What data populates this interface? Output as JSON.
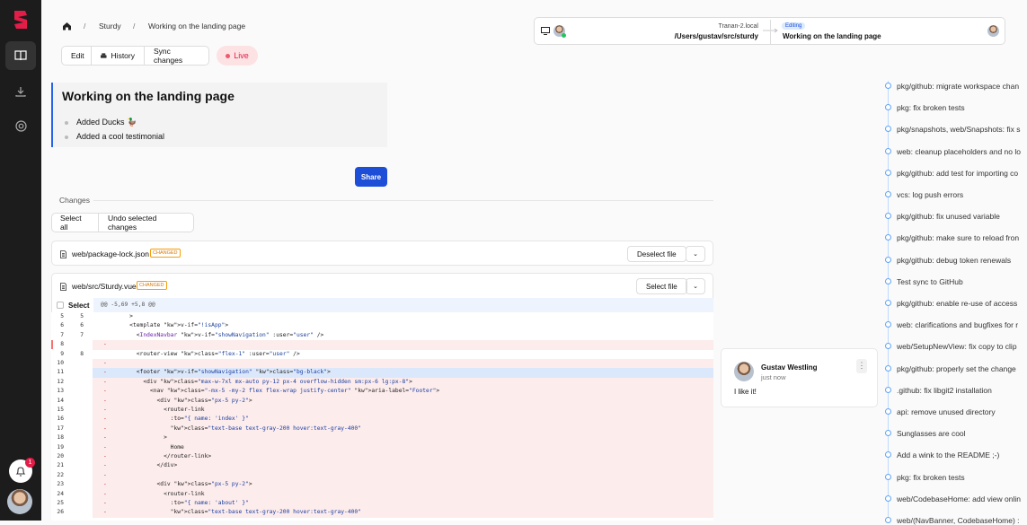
{
  "breadcrumb": {
    "home_icon": "home-icon",
    "repo": "Sturdy",
    "workspace": "Working on the landing page"
  },
  "toolbar": {
    "edit": "Edit",
    "history": "History",
    "sync": "Sync changes",
    "live": "Live"
  },
  "workspace": {
    "title": "Working on the landing page",
    "items": [
      "Added Ducks 🦆",
      "Added a cool testimonial"
    ],
    "share": "Share"
  },
  "changes": {
    "label": "Changes",
    "select_all": "Select all",
    "undo": "Undo selected changes"
  },
  "files": [
    {
      "name": "web/package-lock.json",
      "tag": "CHANGED",
      "button": "Deselect file"
    },
    {
      "name": "web/src/Sturdy.vue",
      "tag": "CHANGED",
      "button": "Select file",
      "select": "Select",
      "hunk": "@@ -5,69 +5,8 @@"
    }
  ],
  "diff_rows": [
    {
      "a": "5",
      "b": "5",
      "s": "",
      "c": "    >",
      "t": "n"
    },
    {
      "a": "6",
      "b": "6",
      "s": "",
      "c": "    <template v-if=\"!isApp\">",
      "t": "n"
    },
    {
      "a": "7",
      "b": "7",
      "s": "",
      "c": "      <IndexNavbar v-if=\"showNavigation\" :user=\"user\" />",
      "t": "n"
    },
    {
      "a": "8",
      "b": "",
      "s": "-",
      "c": "",
      "t": "d"
    },
    {
      "a": "9",
      "b": "8",
      "s": "",
      "c": "      <router-view class=\"flex-1\" :user=\"user\" />",
      "t": "n"
    },
    {
      "a": "10",
      "b": "",
      "s": "-",
      "c": "",
      "t": "d"
    },
    {
      "a": "11",
      "b": "",
      "s": "-",
      "c": "      <footer v-if=\"showNavigation\" class=\"bg-black\">",
      "t": "h"
    },
    {
      "a": "12",
      "b": "",
      "s": "-",
      "c": "        <div class=\"max-w-7xl mx-auto py-12 px-4 overflow-hidden sm:px-6 lg:px-8\">",
      "t": "d"
    },
    {
      "a": "13",
      "b": "",
      "s": "-",
      "c": "          <nav class=\"-mx-5 -my-2 flex flex-wrap justify-center\" aria-label=\"Footer\">",
      "t": "d"
    },
    {
      "a": "14",
      "b": "",
      "s": "-",
      "c": "            <div class=\"px-5 py-2\">",
      "t": "d"
    },
    {
      "a": "15",
      "b": "",
      "s": "-",
      "c": "              <router-link",
      "t": "d"
    },
    {
      "a": "16",
      "b": "",
      "s": "-",
      "c": "                :to=\"{ name: 'index' }\"",
      "t": "d"
    },
    {
      "a": "17",
      "b": "",
      "s": "-",
      "c": "                class=\"text-base text-gray-200 hover:text-gray-400\"",
      "t": "d"
    },
    {
      "a": "18",
      "b": "",
      "s": "-",
      "c": "              >",
      "t": "d"
    },
    {
      "a": "19",
      "b": "",
      "s": "-",
      "c": "                Home",
      "t": "d"
    },
    {
      "a": "20",
      "b": "",
      "s": "-",
      "c": "              </router-link>",
      "t": "d"
    },
    {
      "a": "21",
      "b": "",
      "s": "-",
      "c": "            </div>",
      "t": "d"
    },
    {
      "a": "22",
      "b": "",
      "s": "-",
      "c": "",
      "t": "d"
    },
    {
      "a": "23",
      "b": "",
      "s": "-",
      "c": "            <div class=\"px-5 py-2\">",
      "t": "d"
    },
    {
      "a": "24",
      "b": "",
      "s": "-",
      "c": "              <router-link",
      "t": "d"
    },
    {
      "a": "25",
      "b": "",
      "s": "-",
      "c": "                :to=\"{ name: 'about' }\"",
      "t": "d"
    },
    {
      "a": "26",
      "b": "",
      "s": "-",
      "c": "                class=\"text-base text-gray-200 hover:text-gray-400\"",
      "t": "d"
    }
  ],
  "comment": {
    "author": "Gustav Westling",
    "time": "just now",
    "text": "I like it!"
  },
  "presence": {
    "host": "Tranan-2.local",
    "path": "/Users/gustav/src/sturdy",
    "status": "Editing",
    "workspace": "Working on the landing page"
  },
  "notifications": {
    "count": "1"
  },
  "timeline": [
    "pkg/github: migrate workspace chan",
    "pkg: fix broken tests",
    "pkg/snapshots, web/Snapshots: fix s",
    "web: cleanup placeholders and no lo",
    "pkg/github: add test for importing co",
    "vcs: log push errors",
    "pkg/github: fix unused variable",
    "pkg/github: make sure to reload fron",
    "pkg/github: debug token renewals",
    "Test sync to GitHub",
    "pkg/github: enable re-use of access",
    "web: clarifications and bugfixes for r",
    "web/SetupNewView: fix copy to clip",
    "pkg/github: properly set the change",
    ".github: fix libgit2 installation",
    "api: remove unused directory",
    "Sunglasses are cool",
    "Add a wink to the README ;-)",
    "pkg: fix broken tests",
    "web/CodebaseHome: add view onlin",
    "web/(NavBanner, CodebaseHome) :"
  ]
}
